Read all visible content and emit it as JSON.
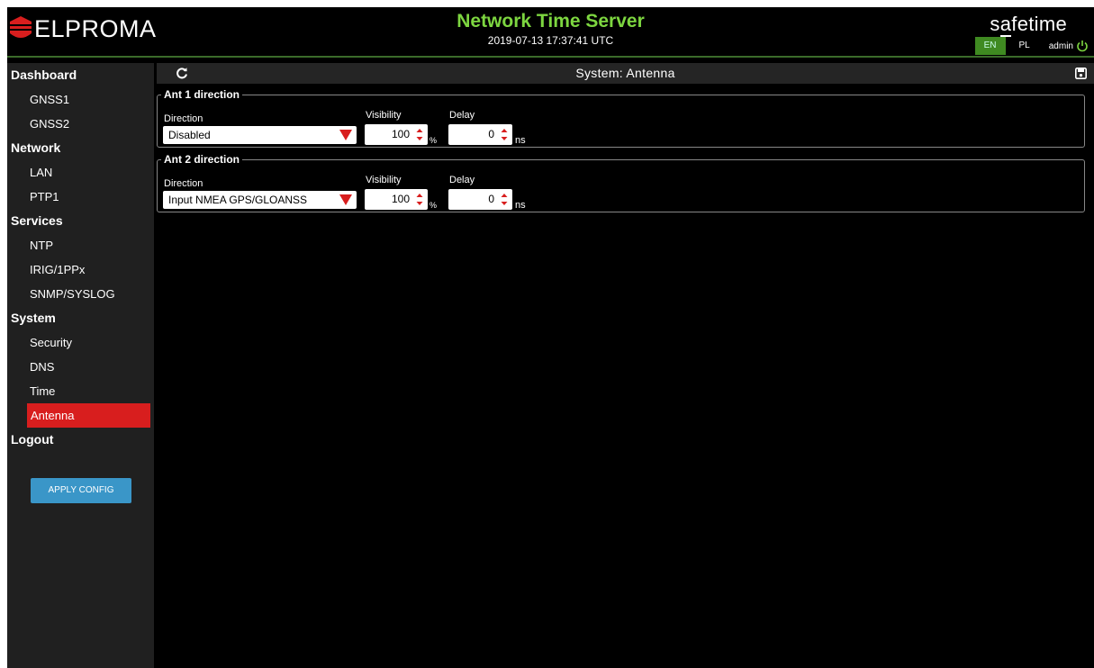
{
  "header": {
    "logo_text": "ELPROMA",
    "title": "Network Time Server",
    "datetime": "2019-07-13 17:37:41 UTC",
    "brand_prefix": "s",
    "brand_mid": "a",
    "brand_suffix": "fetime",
    "lang_en": "EN",
    "lang_pl": "PL",
    "user": "admin",
    "accent_color": "#7dd640"
  },
  "sidebar": {
    "items": [
      {
        "label": "Dashboard",
        "type": "section"
      },
      {
        "label": "GNSS1",
        "type": "item"
      },
      {
        "label": "GNSS2",
        "type": "item"
      },
      {
        "label": "Network",
        "type": "section"
      },
      {
        "label": "LAN",
        "type": "item"
      },
      {
        "label": "PTP1",
        "type": "item"
      },
      {
        "label": "Services",
        "type": "section"
      },
      {
        "label": "NTP",
        "type": "item"
      },
      {
        "label": "IRIG/1PPx",
        "type": "item"
      },
      {
        "label": "SNMP/SYSLOG",
        "type": "item"
      },
      {
        "label": "System",
        "type": "section"
      },
      {
        "label": "Security",
        "type": "item"
      },
      {
        "label": "DNS",
        "type": "item"
      },
      {
        "label": "Time",
        "type": "item"
      },
      {
        "label": "Antenna",
        "type": "item",
        "active": true
      },
      {
        "label": "Logout",
        "type": "section"
      }
    ],
    "apply_button": "APPLY CONFIG"
  },
  "main": {
    "toolbar_title": "System: Antenna",
    "ant1": {
      "legend": "Ant 1 direction",
      "direction_label": "Direction",
      "direction_value": "Disabled",
      "visibility_label": "Visibility",
      "visibility_value": "100",
      "visibility_unit": "%",
      "delay_label": "Delay",
      "delay_value": "0",
      "delay_unit": "ns"
    },
    "ant2": {
      "legend": "Ant 2 direction",
      "direction_label": "Direction",
      "direction_value": "Input NMEA GPS/GLOANSS",
      "visibility_label": "Visibility",
      "visibility_value": "100",
      "visibility_unit": "%",
      "delay_label": "Delay",
      "delay_value": "0",
      "delay_unit": "ns"
    }
  }
}
